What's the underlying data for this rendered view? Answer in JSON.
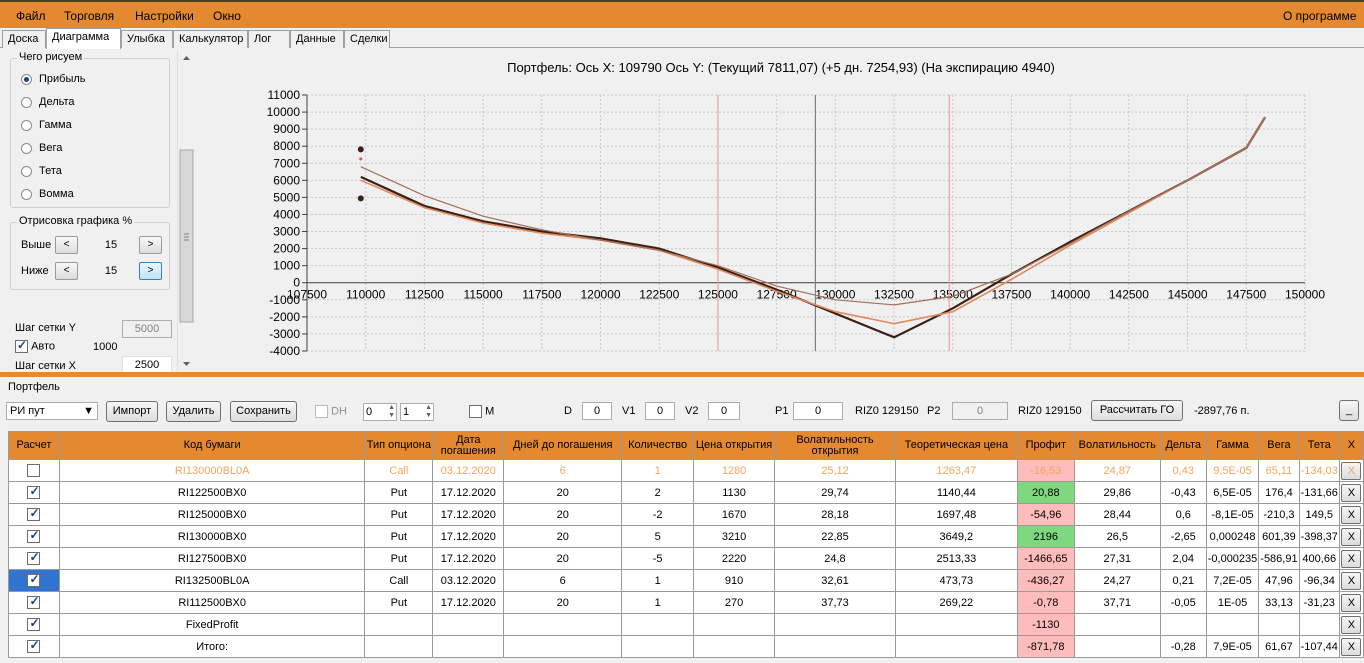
{
  "menu": {
    "file": "Файл",
    "trade": "Торговля",
    "settings": "Настройки",
    "window": "Окно",
    "about": "О программе"
  },
  "tabs": [
    "Доска",
    "Диаграмма",
    "Улыбка",
    "Калькулятор",
    "Лог",
    "Данные",
    "Сделки"
  ],
  "left": {
    "group_title": "Чего рисуем",
    "options": [
      "Прибыль",
      "Дельта",
      "Гамма",
      "Вега",
      "Тета",
      "Вомма"
    ],
    "selected": "Прибыль",
    "draw_title": "Отрисовка графика %",
    "above_label": "Выше",
    "above_value": "15",
    "below_label": "Ниже",
    "below_value": "15",
    "dec": "<",
    "inc": ">",
    "grid_y_label": "Шаг сетки Y",
    "grid_y_value": "5000",
    "auto_label": "Авто",
    "auto_value": "1000",
    "grid_x_label": "Шаг сетки X",
    "grid_x_value": "2500"
  },
  "chart_title": "Портфель: Ось X: 109790 Ось Y:  (Текущий 7811,07)  (+5 дн. 7254,93)  (На экспирацию 4940)",
  "chart_data": {
    "type": "line",
    "title": "Портфель: Ось X: 109790 Ось Y:  (Текущий 7811,07)  (+5 дн. 7254,93)  (На экспирацию 4940)",
    "xlim": [
      107500,
      150000
    ],
    "ylim": [
      -4000,
      11000
    ],
    "x_ticks": [
      107500,
      110000,
      112500,
      115000,
      117500,
      120000,
      122500,
      125000,
      127500,
      130000,
      132500,
      135000,
      137500,
      140000,
      142500,
      145000,
      147500,
      150000
    ],
    "y_ticks": [
      -4000,
      -3000,
      -2000,
      -1000,
      0,
      1000,
      2000,
      3000,
      4000,
      5000,
      6000,
      7000,
      8000,
      9000,
      10000,
      11000
    ],
    "grid": true,
    "vertical_lines": [
      {
        "x": 125000,
        "color": "#f0a0a0"
      },
      {
        "x": 129150,
        "color": "#808080"
      },
      {
        "x": 134850,
        "color": "#f0a0a0"
      }
    ],
    "series": [
      {
        "color": "#3a1f14",
        "points": [
          [
            109790,
            6200
          ],
          [
            112500,
            4500
          ],
          [
            115000,
            3600
          ],
          [
            117500,
            3000
          ],
          [
            120000,
            2600
          ],
          [
            122500,
            2000
          ],
          [
            125000,
            900
          ],
          [
            127500,
            -400
          ],
          [
            130000,
            -1800
          ],
          [
            132500,
            -3200
          ],
          [
            135000,
            -1500
          ],
          [
            137500,
            500
          ],
          [
            140000,
            2400
          ],
          [
            142500,
            4200
          ],
          [
            145000,
            6000
          ],
          [
            147500,
            7900
          ],
          [
            148300,
            9700
          ]
        ]
      },
      {
        "color": "#e08a60",
        "points": [
          [
            109790,
            6000
          ],
          [
            112500,
            4400
          ],
          [
            115000,
            3500
          ],
          [
            117500,
            2900
          ],
          [
            120000,
            2500
          ],
          [
            122500,
            1900
          ],
          [
            125000,
            800
          ],
          [
            127500,
            -500
          ],
          [
            130000,
            -1700
          ],
          [
            132500,
            -2400
          ],
          [
            135000,
            -1700
          ],
          [
            137500,
            200
          ],
          [
            140000,
            2200
          ],
          [
            142500,
            4100
          ],
          [
            145000,
            6000
          ],
          [
            147500,
            7900
          ],
          [
            148300,
            9700
          ]
        ]
      },
      {
        "color": "#a0705a",
        "points": [
          [
            109790,
            6800
          ],
          [
            112500,
            5100
          ],
          [
            115000,
            3900
          ],
          [
            117500,
            3100
          ],
          [
            120000,
            2500
          ],
          [
            122500,
            1900
          ],
          [
            125000,
            1000
          ],
          [
            127500,
            -200
          ],
          [
            130000,
            -1000
          ],
          [
            132500,
            -1300
          ],
          [
            135000,
            -800
          ],
          [
            137500,
            500
          ],
          [
            140000,
            2300
          ],
          [
            142500,
            4200
          ],
          [
            145000,
            6000
          ],
          [
            147500,
            7900
          ],
          [
            148300,
            9700
          ]
        ]
      }
    ],
    "markers": [
      {
        "x": 109790,
        "y": 7811,
        "color": "#3a1f14"
      },
      {
        "x": 109790,
        "y": 7255,
        "color": "#e05a3a"
      },
      {
        "x": 109790,
        "y": 4940,
        "color": "#3a1f14"
      }
    ]
  },
  "portfolio": {
    "label": "Портфель",
    "combo": "РИ пут",
    "import": "Импорт",
    "delete": "Удалить",
    "save": "Сохранить",
    "dh": "DH",
    "dh1": "0",
    "dh2": "1",
    "m": "M",
    "d": "D",
    "d_val": "0",
    "v1": "V1",
    "v1_val": "0",
    "v2": "V2",
    "v2_val": "0",
    "p1": "P1",
    "p1_val": "0",
    "riz1": "RIZ0 129150",
    "p2": "P2",
    "p2_val": "0",
    "riz2": "RIZ0 129150",
    "calc": "Рассчитать ГО",
    "go_value": "-2897,76 п.",
    "min": "_"
  },
  "table": {
    "headers": [
      "Расчет",
      "Код бумаги",
      "Тип опциона",
      "Дата погашения",
      "Дней до погашения",
      "Количество",
      "Цена открытия",
      "Волатильность открытия",
      "Теоретическая цена",
      "Профит",
      "Волатильность",
      "Дельта",
      "Гамма",
      "Вега",
      "Тета",
      "X"
    ],
    "rows": [
      {
        "checked": false,
        "dim": true,
        "cells": [
          "RI130000BL0A",
          "Call",
          "03.12.2020",
          "6",
          "1",
          "1280",
          "25,12",
          "1263,47",
          "-16,53",
          "24,87",
          "0,43",
          "9,5E-05",
          "65,11",
          "-134,03"
        ],
        "profit": "pink"
      },
      {
        "checked": true,
        "cells": [
          "RI122500BX0",
          "Put",
          "17.12.2020",
          "20",
          "2",
          "1130",
          "29,74",
          "1140,44",
          "20,88",
          "29,86",
          "-0,43",
          "6,5E-05",
          "176,4",
          "-131,66"
        ],
        "profit": "green"
      },
      {
        "checked": true,
        "cells": [
          "RI125000BX0",
          "Put",
          "17.12.2020",
          "20",
          "-2",
          "1670",
          "28,18",
          "1697,48",
          "-54,96",
          "28,44",
          "0,6",
          "-8,1E-05",
          "-210,3",
          "149,5"
        ],
        "profit": "pink"
      },
      {
        "checked": true,
        "cells": [
          "RI130000BX0",
          "Put",
          "17.12.2020",
          "20",
          "5",
          "3210",
          "22,85",
          "3649,2",
          "2196",
          "26,5",
          "-2,65",
          "0,000248",
          "601,39",
          "-398,37"
        ],
        "profit": "green"
      },
      {
        "checked": true,
        "cells": [
          "RI127500BX0",
          "Put",
          "17.12.2020",
          "20",
          "-5",
          "2220",
          "24,8",
          "2513,33",
          "-1466,65",
          "27,31",
          "2,04",
          "-0,000235",
          "-586,91",
          "400,66"
        ],
        "profit": "pink"
      },
      {
        "checked": true,
        "sel": true,
        "cells": [
          "RI132500BL0A",
          "Call",
          "03.12.2020",
          "6",
          "1",
          "910",
          "32,61",
          "473,73",
          "-436,27",
          "24,27",
          "0,21",
          "7,2E-05",
          "47,96",
          "-96,34"
        ],
        "profit": "pink"
      },
      {
        "checked": true,
        "cells": [
          "RI112500BX0",
          "Put",
          "17.12.2020",
          "20",
          "1",
          "270",
          "37,73",
          "269,22",
          "-0,78",
          "37,71",
          "-0,05",
          "1E-05",
          "33,13",
          "-31,23"
        ],
        "profit": "pink"
      },
      {
        "checked": true,
        "cells": [
          "FixedProfit",
          "",
          "",
          "",
          "",
          "",
          "",
          "",
          "-1130",
          "",
          "",
          "",
          "",
          ""
        ],
        "profit": "pink"
      },
      {
        "checked": true,
        "cells": [
          "Итого:",
          "",
          "",
          "",
          "",
          "",
          "",
          "",
          "-871,78",
          "",
          "-0,28",
          "7,9E-05",
          "61,67",
          "-107,44"
        ],
        "profit": "pink"
      }
    ],
    "x_label": "X"
  }
}
